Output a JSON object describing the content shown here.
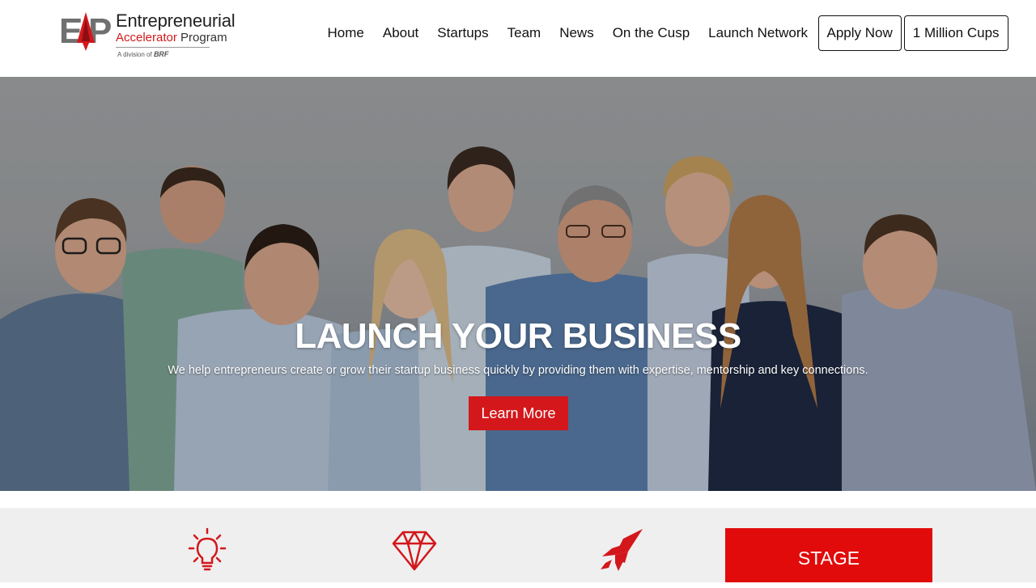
{
  "brand": {
    "title": "Entrepreneurial",
    "subtitle_red": "Accelerator",
    "subtitle_dark": "Program",
    "division_prefix": "A division of",
    "division_name": "BRF",
    "logo_letters": "EAP"
  },
  "nav": {
    "links": [
      "Home",
      "About",
      "Startups",
      "Team",
      "News",
      "On the Cusp",
      "Launch Network"
    ],
    "buttons": [
      "Apply Now",
      "1 Million Cups"
    ]
  },
  "hero": {
    "title": "LAUNCH YOUR BUSINESS",
    "text": "We help entrepreneurs create or grow their startup business quickly by providing them with expertise, mentorship and key connections.",
    "cta": "Learn More"
  },
  "features": {
    "icons": [
      "lightbulb-icon",
      "diamond-icon",
      "rocket-icon"
    ],
    "stage_label": "STAGE"
  },
  "colors": {
    "accent": "#d3171b",
    "stage": "#e10b0b",
    "features_bg": "#efefef"
  }
}
